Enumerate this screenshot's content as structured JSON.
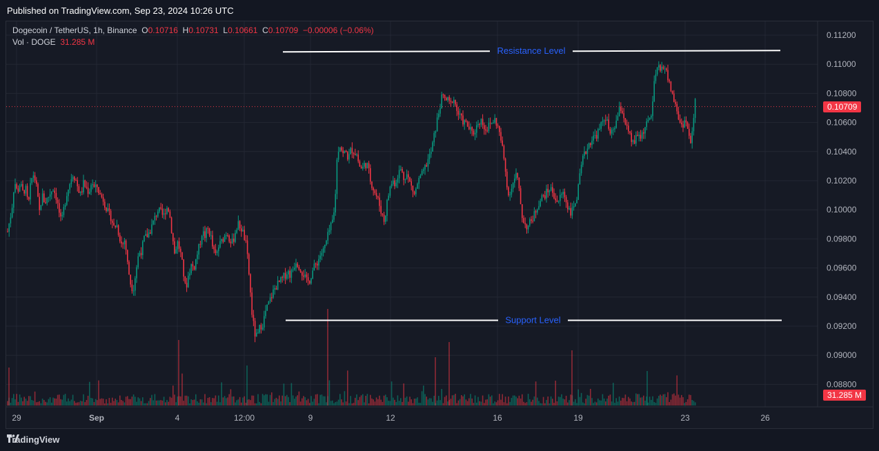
{
  "header": {
    "published": "Published on TradingView.com, Sep 23, 2024 10:26 UTC"
  },
  "legend": {
    "symbol": "Dogecoin / TetherUS, 1h, Binance",
    "o_label": "O",
    "o": "0.10716",
    "h_label": "H",
    "h": "0.10731",
    "l_label": "L",
    "l": "0.10661",
    "c_label": "C",
    "c": "0.10709",
    "change": "−0.00006 (−0.06%)",
    "vol_label": "Vol · DOGE",
    "vol": "31.285 M"
  },
  "footer": {
    "brand": "TradingView"
  },
  "colors": {
    "up": "#089981",
    "down": "#f23645",
    "grid": "#232733",
    "text": "#b2b5be",
    "annotation": "#2962ff",
    "line": "#ffffff",
    "price_line": "#f23645"
  },
  "chart_data": {
    "type": "candlestick",
    "symbol": "DOGE/USDT",
    "timeframe": "1h",
    "y_ticks": [
      "0.11200",
      "0.11000",
      "0.10800",
      "0.10600",
      "0.10400",
      "0.10200",
      "0.10000",
      "0.09800",
      "0.09600",
      "0.09400",
      "0.09200",
      "0.09000",
      "0.08800"
    ],
    "y_range": [
      0.0882,
      0.1122
    ],
    "x_ticks": [
      "29",
      "Sep",
      "4",
      "12:00",
      "9",
      "12",
      "16",
      "19",
      "23",
      "26"
    ],
    "last_price": "0.10709",
    "last_volume": "31.285 M",
    "annotations": [
      {
        "label": "Resistance Level",
        "price": 0.1109
      },
      {
        "label": "Support Level",
        "price": 0.0924
      }
    ],
    "path_points": [
      [
        0,
        0.0985
      ],
      [
        6,
        0.1
      ],
      [
        10,
        0.102
      ],
      [
        14,
        0.1012
      ],
      [
        18,
        0.1018
      ],
      [
        22,
        0.1012
      ],
      [
        26,
        0.1015
      ],
      [
        30,
        0.1002
      ],
      [
        34,
        0.102
      ],
      [
        38,
        0.1025
      ],
      [
        42,
        0.1015
      ],
      [
        46,
        0.0998
      ],
      [
        50,
        0.101
      ],
      [
        54,
        0.1005
      ],
      [
        58,
        0.1008
      ],
      [
        62,
        0.1012
      ],
      [
        66,
        0.1015
      ],
      [
        70,
        0.101
      ],
      [
        74,
        0.1
      ],
      [
        78,
        0.099
      ],
      [
        82,
        0.1002
      ],
      [
        86,
        0.1012
      ],
      [
        90,
        0.1018
      ],
      [
        94,
        0.1025
      ],
      [
        98,
        0.1022
      ],
      [
        102,
        0.1015
      ],
      [
        106,
        0.101
      ],
      [
        110,
        0.1018
      ],
      [
        114,
        0.1015
      ],
      [
        118,
        0.1012
      ],
      [
        122,
        0.102
      ],
      [
        126,
        0.1014
      ],
      [
        130,
        0.1016
      ],
      [
        134,
        0.101
      ],
      [
        138,
        0.1008
      ],
      [
        142,
        0.1003
      ],
      [
        146,
        0.0997
      ],
      [
        150,
        0.0995
      ],
      [
        154,
        0.0988
      ],
      [
        158,
        0.099
      ],
      [
        162,
        0.0982
      ],
      [
        166,
        0.0975
      ],
      [
        170,
        0.098
      ],
      [
        174,
        0.0962
      ],
      [
        178,
        0.095
      ],
      [
        182,
        0.0945
      ],
      [
        186,
        0.0958
      ],
      [
        190,
        0.097
      ],
      [
        194,
        0.0972
      ],
      [
        198,
        0.098
      ],
      [
        202,
        0.0982
      ],
      [
        206,
        0.0985
      ],
      [
        210,
        0.099
      ],
      [
        214,
        0.0995
      ],
      [
        218,
        0.1
      ],
      [
        222,
        0.0998
      ],
      [
        226,
        0.0995
      ],
      [
        230,
        0.1002
      ],
      [
        234,
        0.1
      ],
      [
        238,
        0.0985
      ],
      [
        242,
        0.097
      ],
      [
        246,
        0.0978
      ],
      [
        250,
        0.0972
      ],
      [
        254,
        0.096
      ],
      [
        258,
        0.0945
      ],
      [
        262,
        0.0955
      ],
      [
        266,
        0.0962
      ],
      [
        270,
        0.096
      ],
      [
        274,
        0.0968
      ],
      [
        278,
        0.0975
      ],
      [
        282,
        0.0985
      ],
      [
        286,
        0.0982
      ],
      [
        290,
        0.0987
      ],
      [
        294,
        0.0983
      ],
      [
        298,
        0.0972
      ],
      [
        302,
        0.0968
      ],
      [
        306,
        0.0975
      ],
      [
        310,
        0.0978
      ],
      [
        314,
        0.0982
      ],
      [
        318,
        0.0985
      ],
      [
        322,
        0.098
      ],
      [
        326,
        0.0977
      ],
      [
        330,
        0.0985
      ],
      [
        334,
        0.099
      ],
      [
        338,
        0.0988
      ],
      [
        342,
        0.0983
      ],
      [
        346,
        0.0975
      ],
      [
        350,
        0.0955
      ],
      [
        354,
        0.093
      ],
      [
        358,
        0.0915
      ],
      [
        362,
        0.0912
      ],
      [
        366,
        0.092
      ],
      [
        370,
        0.0922
      ],
      [
        374,
        0.093
      ],
      [
        378,
        0.0935
      ],
      [
        382,
        0.094
      ],
      [
        386,
        0.0945
      ],
      [
        390,
        0.0948
      ],
      [
        394,
        0.095
      ],
      [
        398,
        0.0952
      ],
      [
        402,
        0.0955
      ],
      [
        406,
        0.0958
      ],
      [
        410,
        0.0955
      ],
      [
        414,
        0.096
      ],
      [
        418,
        0.0965
      ],
      [
        422,
        0.0962
      ],
      [
        426,
        0.0958
      ],
      [
        430,
        0.0955
      ],
      [
        434,
        0.095
      ],
      [
        438,
        0.0952
      ],
      [
        442,
        0.0958
      ],
      [
        446,
        0.0962
      ],
      [
        450,
        0.0965
      ],
      [
        454,
        0.097
      ],
      [
        458,
        0.0972
      ],
      [
        462,
        0.0978
      ],
      [
        466,
        0.0985
      ],
      [
        470,
        0.099
      ],
      [
        474,
        0.1
      ],
      [
        478,
        0.104
      ],
      [
        482,
        0.1045
      ],
      [
        486,
        0.1038
      ],
      [
        490,
        0.104
      ],
      [
        494,
        0.1035
      ],
      [
        498,
        0.1042
      ],
      [
        502,
        0.104
      ],
      [
        506,
        0.1038
      ],
      [
        510,
        0.103
      ],
      [
        514,
        0.1028
      ],
      [
        518,
        0.1032
      ],
      [
        522,
        0.103
      ],
      [
        526,
        0.102
      ],
      [
        530,
        0.1015
      ],
      [
        534,
        0.101
      ],
      [
        538,
        0.1005
      ],
      [
        542,
        0.0998
      ],
      [
        546,
        0.0992
      ],
      [
        550,
        0.1005
      ],
      [
        554,
        0.1015
      ],
      [
        558,
        0.102
      ],
      [
        562,
        0.1018
      ],
      [
        566,
        0.1025
      ],
      [
        570,
        0.1028
      ],
      [
        574,
        0.1022
      ],
      [
        578,
        0.1025
      ],
      [
        582,
        0.102
      ],
      [
        586,
        0.1015
      ],
      [
        590,
        0.101
      ],
      [
        594,
        0.1018
      ],
      [
        598,
        0.1022
      ],
      [
        602,
        0.1025
      ],
      [
        606,
        0.103
      ],
      [
        610,
        0.1035
      ],
      [
        614,
        0.104
      ],
      [
        618,
        0.105
      ],
      [
        622,
        0.106
      ],
      [
        626,
        0.107
      ],
      [
        630,
        0.1078
      ],
      [
        634,
        0.1076
      ],
      [
        638,
        0.1075
      ],
      [
        642,
        0.1072
      ],
      [
        646,
        0.1078
      ],
      [
        650,
        0.107
      ],
      [
        654,
        0.1065
      ],
      [
        658,
        0.1062
      ],
      [
        662,
        0.106
      ],
      [
        666,
        0.1058
      ],
      [
        670,
        0.1055
      ],
      [
        674,
        0.1052
      ],
      [
        678,
        0.1055
      ],
      [
        682,
        0.106
      ],
      [
        686,
        0.1062
      ],
      [
        690,
        0.1058
      ],
      [
        694,
        0.1055
      ],
      [
        698,
        0.1058
      ],
      [
        702,
        0.106
      ],
      [
        706,
        0.1062
      ],
      [
        710,
        0.1058
      ],
      [
        714,
        0.105
      ],
      [
        718,
        0.104
      ],
      [
        722,
        0.1025
      ],
      [
        726,
        0.101
      ],
      [
        730,
        0.1015
      ],
      [
        734,
        0.102
      ],
      [
        738,
        0.1025
      ],
      [
        742,
        0.101
      ],
      [
        746,
        0.0995
      ],
      [
        750,
        0.099
      ],
      [
        754,
        0.0988
      ],
      [
        758,
        0.0992
      ],
      [
        762,
        0.0995
      ],
      [
        766,
        0.1
      ],
      [
        770,
        0.1005
      ],
      [
        774,
        0.1008
      ],
      [
        778,
        0.101
      ],
      [
        782,
        0.1012
      ],
      [
        786,
        0.1015
      ],
      [
        790,
        0.1012
      ],
      [
        794,
        0.1008
      ],
      [
        798,
        0.1005
      ],
      [
        802,
        0.101
      ],
      [
        806,
        0.1012
      ],
      [
        810,
        0.1005
      ],
      [
        814,
        0.1
      ],
      [
        818,
        0.0998
      ],
      [
        822,
        0.1005
      ],
      [
        826,
        0.101
      ],
      [
        830,
        0.1025
      ],
      [
        834,
        0.1035
      ],
      [
        838,
        0.104
      ],
      [
        842,
        0.1045
      ],
      [
        846,
        0.1048
      ],
      [
        850,
        0.105
      ],
      [
        854,
        0.1052
      ],
      [
        858,
        0.1055
      ],
      [
        862,
        0.106
      ],
      [
        866,
        0.1065
      ],
      [
        870,
        0.1058
      ],
      [
        874,
        0.105
      ],
      [
        878,
        0.1055
      ],
      [
        882,
        0.106
      ],
      [
        886,
        0.1068
      ],
      [
        890,
        0.107
      ],
      [
        894,
        0.1062
      ],
      [
        898,
        0.1055
      ],
      [
        902,
        0.105
      ],
      [
        906,
        0.1045
      ],
      [
        910,
        0.1048
      ],
      [
        914,
        0.1052
      ],
      [
        918,
        0.105
      ],
      [
        922,
        0.1055
      ],
      [
        926,
        0.1058
      ],
      [
        930,
        0.1062
      ],
      [
        934,
        0.1068
      ],
      [
        938,
        0.109
      ],
      [
        942,
        0.1098
      ],
      [
        946,
        0.1095
      ],
      [
        950,
        0.11
      ],
      [
        954,
        0.1096
      ],
      [
        958,
        0.1088
      ],
      [
        962,
        0.1082
      ],
      [
        966,
        0.1075
      ],
      [
        970,
        0.1068
      ],
      [
        974,
        0.106
      ],
      [
        978,
        0.1058
      ],
      [
        982,
        0.1062
      ],
      [
        986,
        0.1055
      ],
      [
        990,
        0.1045
      ],
      [
        994,
        0.106
      ],
      [
        998,
        0.1082
      ],
      [
        1002,
        0.1078
      ],
      [
        1006,
        0.107
      ],
      [
        1010,
        0.1071
      ]
    ]
  }
}
